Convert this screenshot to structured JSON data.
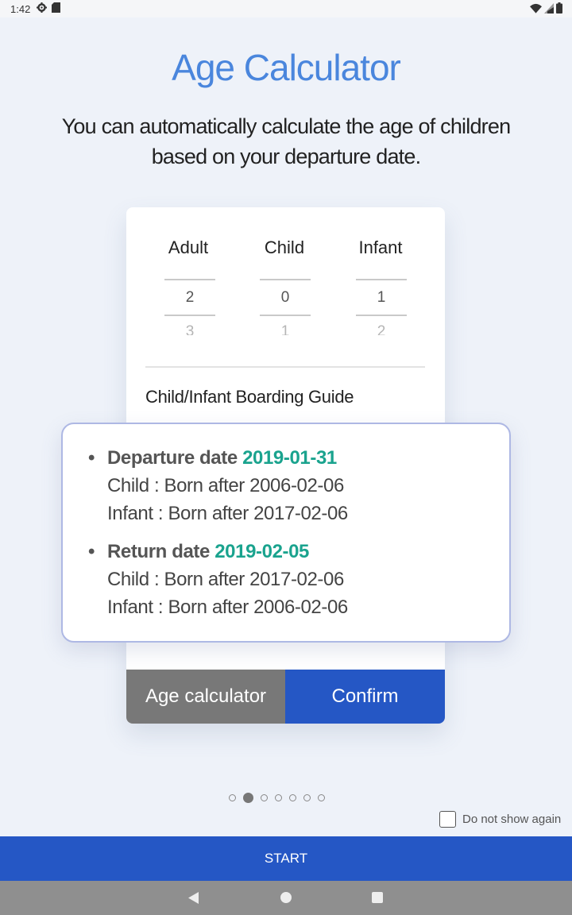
{
  "status_bar": {
    "time": "1:42",
    "icons": [
      "settings-gear-icon",
      "sd-card-icon",
      "wifi-icon",
      "cell-signal-icon",
      "battery-icon"
    ]
  },
  "header": {
    "title": "Age Calculator",
    "subtitle_line1": "You can automatically calculate the age of children",
    "subtitle_line2": "based on your departure date."
  },
  "passengers": {
    "adult": {
      "label": "Adult",
      "value": "2",
      "next": "3"
    },
    "child": {
      "label": "Child",
      "value": "0",
      "next": "1"
    },
    "infant": {
      "label": "Infant",
      "value": "1",
      "next": "2"
    }
  },
  "guide": {
    "label": "Child/Infant Boarding Guide",
    "departure": {
      "bullet": "•",
      "heading": "Departure date",
      "date": "2019-01-31",
      "child": "Child : Born after 2006-02-06",
      "infant": "Infant : Born after 2017-02-06"
    },
    "return": {
      "bullet": "•",
      "heading": "Return date",
      "date": "2019-02-05",
      "child": "Child : Born after 2017-02-06",
      "infant": "Infant : Born after 2006-02-06"
    }
  },
  "buttons": {
    "age_calculator": "Age calculator",
    "confirm": "Confirm"
  },
  "pager": {
    "total": 7,
    "active_index": 1
  },
  "do_not_show": {
    "label": "Do not show again",
    "checked": false
  },
  "start_button": "START",
  "colors": {
    "title_blue": "#4a86dd",
    "primary_blue": "#2557c5",
    "gray_button": "#787878",
    "date_green": "#1aa38e",
    "background": "#eef2f9"
  }
}
